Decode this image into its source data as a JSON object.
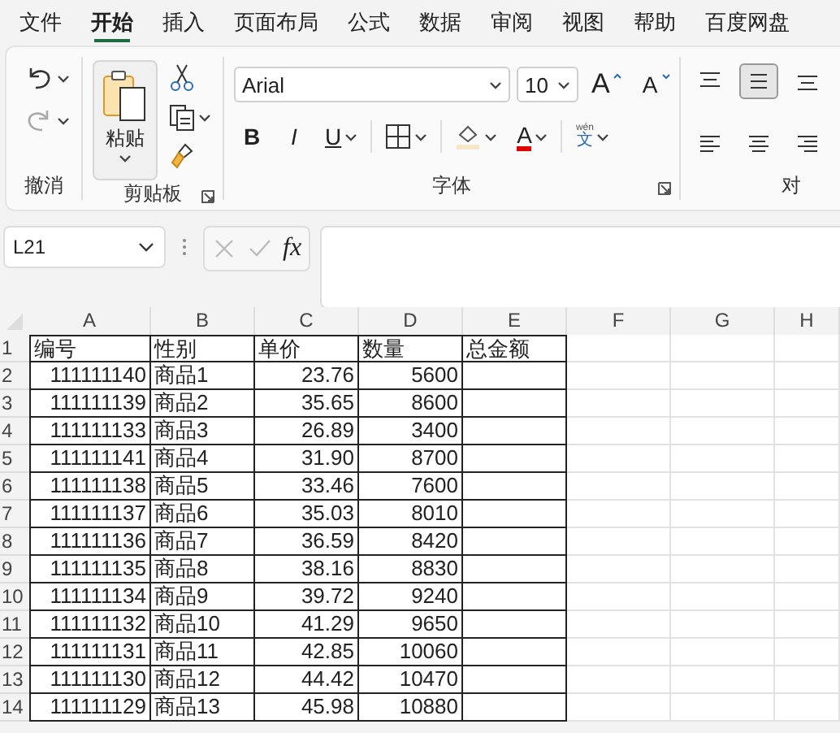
{
  "menu_tabs": [
    {
      "label": "文件",
      "selected": false
    },
    {
      "label": "开始",
      "selected": true
    },
    {
      "label": "插入",
      "selected": false
    },
    {
      "label": "页面布局",
      "selected": false
    },
    {
      "label": "公式",
      "selected": false
    },
    {
      "label": "数据",
      "selected": false
    },
    {
      "label": "审阅",
      "selected": false
    },
    {
      "label": "视图",
      "selected": false
    },
    {
      "label": "帮助",
      "selected": false
    },
    {
      "label": "百度网盘",
      "selected": false
    }
  ],
  "ribbon": {
    "groups": [
      {
        "kind": "undo",
        "label": "撤消",
        "launcher": false,
        "buttons": [
          {
            "kind": "undo",
            "disabled": false
          },
          {
            "kind": "redo",
            "disabled": true
          }
        ]
      },
      {
        "kind": "clipboard",
        "label": "剪贴板",
        "launcher": true,
        "paste_label": "粘贴"
      },
      {
        "kind": "font",
        "label": "字体",
        "launcher": true,
        "font_name": "Arial",
        "font_size": "10",
        "grow": "A",
        "shrink": "A",
        "bold": "B",
        "italic": "I",
        "underline": "U",
        "font_color": "A",
        "phonetic_label": "wén",
        "phonetic_char": "文"
      },
      {
        "kind": "alignment",
        "label": "对",
        "launcher": false,
        "buttons": [
          {
            "kind": "align-top",
            "selected": false
          },
          {
            "kind": "align-middle",
            "selected": true
          },
          {
            "kind": "align-bottom",
            "selected": false
          },
          {
            "kind": "align-left",
            "selected": false
          },
          {
            "kind": "align-center",
            "selected": false
          },
          {
            "kind": "align-right",
            "selected": false
          }
        ]
      }
    ]
  },
  "formula_bar": {
    "name_box": "L21",
    "function_label": "fx",
    "edit_buttons": [
      {
        "kind": "cancel",
        "disabled": true
      },
      {
        "kind": "enter",
        "disabled": true
      }
    ]
  },
  "sheet": {
    "columns": [
      {
        "label": "A",
        "in_table": true
      },
      {
        "label": "B",
        "in_table": true
      },
      {
        "label": "C",
        "in_table": true
      },
      {
        "label": "D",
        "in_table": true
      },
      {
        "label": "E",
        "in_table": true
      },
      {
        "label": "F",
        "in_table": false
      },
      {
        "label": "G",
        "in_table": false
      },
      {
        "label": "H",
        "in_table": false
      }
    ],
    "rows": [
      {
        "number": "1",
        "kind": "header",
        "cells": [
          {
            "kind": "text",
            "text": "编号"
          },
          {
            "kind": "text",
            "text": "性别"
          },
          {
            "kind": "text",
            "text": "单价"
          },
          {
            "kind": "text",
            "text": "数量"
          },
          {
            "kind": "text",
            "text": "总金额"
          }
        ]
      },
      {
        "number": "2",
        "kind": "data",
        "cells": [
          {
            "kind": "number",
            "text": "111111140"
          },
          {
            "kind": "text",
            "text": "商品1"
          },
          {
            "kind": "number",
            "text": "23.76"
          },
          {
            "kind": "number",
            "text": "5600"
          }
        ]
      },
      {
        "number": "3",
        "kind": "data",
        "cells": [
          {
            "kind": "number",
            "text": "111111139"
          },
          {
            "kind": "text",
            "text": "商品2"
          },
          {
            "kind": "number",
            "text": "35.65"
          },
          {
            "kind": "number",
            "text": "8600"
          }
        ]
      },
      {
        "number": "4",
        "kind": "data",
        "cells": [
          {
            "kind": "number",
            "text": "111111133"
          },
          {
            "kind": "text",
            "text": "商品3"
          },
          {
            "kind": "number",
            "text": "26.89"
          },
          {
            "kind": "number",
            "text": "3400"
          }
        ]
      },
      {
        "number": "5",
        "kind": "data",
        "cells": [
          {
            "kind": "number",
            "text": "111111141"
          },
          {
            "kind": "text",
            "text": "商品4"
          },
          {
            "kind": "number",
            "text": "31.90"
          },
          {
            "kind": "number",
            "text": "8700"
          }
        ]
      },
      {
        "number": "6",
        "kind": "data",
        "cells": [
          {
            "kind": "number",
            "text": "111111138"
          },
          {
            "kind": "text",
            "text": "商品5"
          },
          {
            "kind": "number",
            "text": "33.46"
          },
          {
            "kind": "number",
            "text": "7600"
          }
        ]
      },
      {
        "number": "7",
        "kind": "data",
        "cells": [
          {
            "kind": "number",
            "text": "111111137"
          },
          {
            "kind": "text",
            "text": "商品6"
          },
          {
            "kind": "number",
            "text": "35.03"
          },
          {
            "kind": "number",
            "text": "8010"
          }
        ]
      },
      {
        "number": "8",
        "kind": "data",
        "cells": [
          {
            "kind": "number",
            "text": "111111136"
          },
          {
            "kind": "text",
            "text": "商品7"
          },
          {
            "kind": "number",
            "text": "36.59"
          },
          {
            "kind": "number",
            "text": "8420"
          }
        ]
      },
      {
        "number": "9",
        "kind": "data",
        "cells": [
          {
            "kind": "number",
            "text": "111111135"
          },
          {
            "kind": "text",
            "text": "商品8"
          },
          {
            "kind": "number",
            "text": "38.16"
          },
          {
            "kind": "number",
            "text": "8830"
          }
        ]
      },
      {
        "number": "10",
        "kind": "data",
        "cells": [
          {
            "kind": "number",
            "text": "111111134"
          },
          {
            "kind": "text",
            "text": "商品9"
          },
          {
            "kind": "number",
            "text": "39.72"
          },
          {
            "kind": "number",
            "text": "9240"
          }
        ]
      },
      {
        "number": "11",
        "kind": "data",
        "cells": [
          {
            "kind": "number",
            "text": "111111132"
          },
          {
            "kind": "text",
            "text": "商品10"
          },
          {
            "kind": "number",
            "text": "41.29"
          },
          {
            "kind": "number",
            "text": "9650"
          }
        ]
      },
      {
        "number": "12",
        "kind": "data",
        "cells": [
          {
            "kind": "number",
            "text": "111111131"
          },
          {
            "kind": "text",
            "text": "商品11"
          },
          {
            "kind": "number",
            "text": "42.85"
          },
          {
            "kind": "number",
            "text": "10060"
          }
        ]
      },
      {
        "number": "13",
        "kind": "data",
        "cells": [
          {
            "kind": "number",
            "text": "111111130"
          },
          {
            "kind": "text",
            "text": "商品12"
          },
          {
            "kind": "number",
            "text": "44.42"
          },
          {
            "kind": "number",
            "text": "10470"
          }
        ]
      },
      {
        "number": "14",
        "kind": "data",
        "cells": [
          {
            "kind": "number",
            "text": "111111129"
          },
          {
            "kind": "text",
            "text": "商品13"
          },
          {
            "kind": "number",
            "text": "45.98"
          },
          {
            "kind": "number",
            "text": "10880"
          }
        ]
      }
    ]
  }
}
